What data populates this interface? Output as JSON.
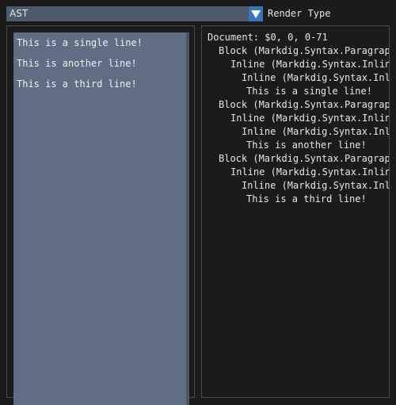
{
  "toolbar": {
    "render_type_value": "AST",
    "render_type_label": "Render Type"
  },
  "editor": {
    "lines": [
      "This is a single line!",
      "This is another line!",
      "This is a third line!"
    ]
  },
  "ast_view": {
    "lines": [
      "Document: $0, 0, 0-71",
      "Block (Markdig.Syntax.Paragraph",
      "Inline (Markdig.Syntax.Inline",
      "Inline (Markdig.Syntax.Inl",
      "This is a single line!",
      "Block (Markdig.Syntax.Paragraph",
      "Inline (Markdig.Syntax.Inline",
      "Inline (Markdig.Syntax.Inl",
      "This is another line!",
      "Block (Markdig.Syntax.Paragraph",
      "Inline (Markdig.Syntax.Inline",
      "Inline (Markdig.Syntax.Inl",
      "This is a third line!"
    ]
  },
  "colors": {
    "accent": "#3b74b8",
    "editor_bg": "#5f6e82",
    "combo_bg": "#4d5a6c",
    "window_bg": "#1b1b1b"
  },
  "icons": {
    "combo_arrow": "triangle-down-icon"
  }
}
